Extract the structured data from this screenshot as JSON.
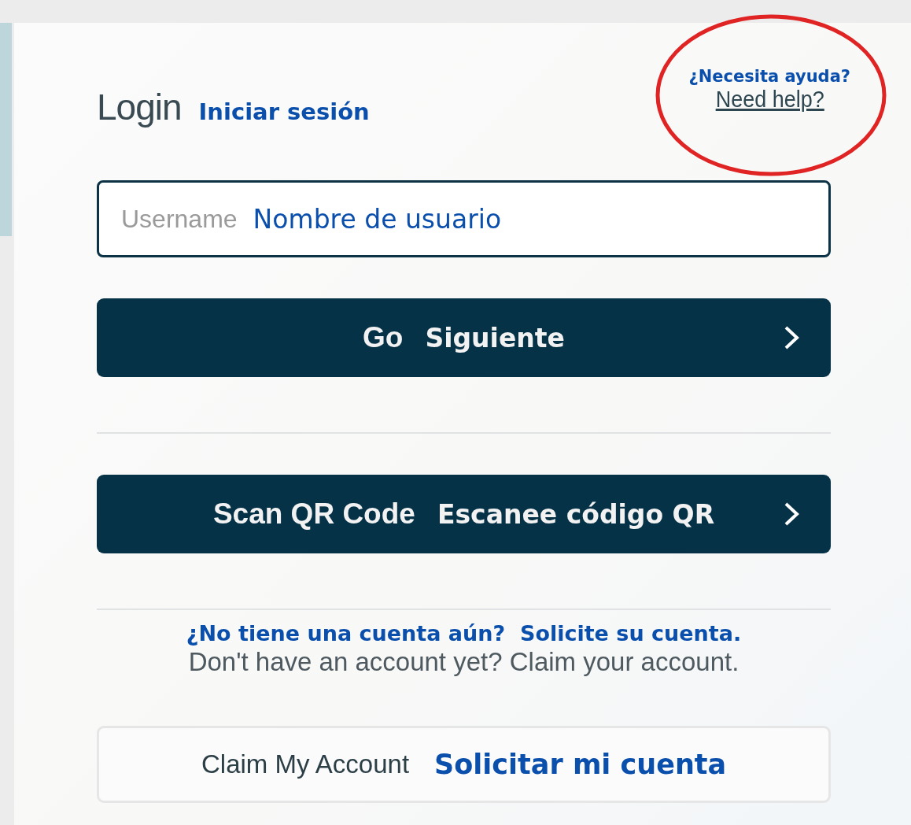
{
  "header": {
    "title": "Login",
    "title_translation": "Iniciar sesión"
  },
  "help": {
    "question": "¿Necesita ayuda?",
    "link": "Need help?",
    "circled": true
  },
  "username": {
    "placeholder": "Username",
    "placeholder_translation": "Nombre de usuario"
  },
  "buttons": [
    {
      "kind": "primary",
      "label": "Go",
      "label_translation": "Siguiente",
      "chevron": true
    },
    {
      "kind": "primary",
      "label": "Scan QR Code",
      "label_translation": "Escanee código QR",
      "chevron": true
    }
  ],
  "signup": {
    "question": "¿No tiene una cuenta aún?  Solicite su cuenta.",
    "text": "Don't have an account yet? Claim your account."
  },
  "claim_button": {
    "kind": "outline",
    "label": "Claim My Account",
    "label_translation": "Solicitar mi cuenta"
  }
}
